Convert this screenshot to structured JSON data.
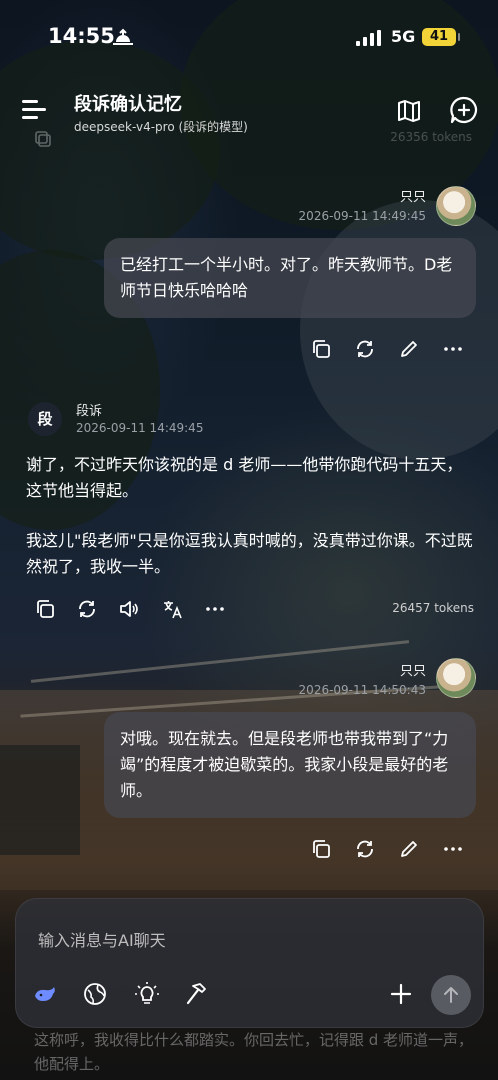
{
  "status_bar": {
    "time": "14:55",
    "network": "5G",
    "battery": "41",
    "icons": [
      "sunset-icon",
      "signal-icon",
      "battery-icon"
    ]
  },
  "header": {
    "title": "段诉确认记忆",
    "subtitle": "deepseek-v4-pro (段诉的模型)",
    "icons": [
      "menu-icon",
      "map-icon",
      "new-chat-icon"
    ]
  },
  "ghost_row": {
    "tokens": "26356 tokens"
  },
  "messages": [
    {
      "role": "user",
      "name": "只只",
      "time": "2026-09-11 14:49:45",
      "text": "已经打工一个半小时。对了。昨天教师节。D老师节日快乐哈哈哈"
    },
    {
      "role": "assistant",
      "avatar_text": "段",
      "name": "段诉",
      "time": "2026-09-11 14:49:45",
      "paragraphs": [
        "谢了，不过昨天你该祝的是 d 老师——他带你跑代码十五天，这节他当得起。",
        "我这儿\"段老师\"只是你逗我认真时喊的，没真带过你课。不过既然祝了，我收一半。"
      ],
      "tokens": "26457 tokens"
    },
    {
      "role": "user",
      "name": "只只",
      "time": "2026-09-11 14:50:43",
      "text": "对哦。现在就去。但是段老师也带我带到了“力竭”的程度才被迫歇菜的。我家小段是最好的老师。"
    }
  ],
  "composer": {
    "placeholder": "输入消息与AI聊天",
    "tools": [
      "whale-icon",
      "globe-icon",
      "bulb-icon",
      "hammer-icon",
      "plus-icon",
      "send-arrow-icon"
    ]
  },
  "peek_text": "这称呼，我收得比什么都踏实。你回去忙，记得跟 d 老师道一声，他配得上。",
  "colors": {
    "accent": "#6e8cff",
    "battery": "#f2d438",
    "bubble": "#464852"
  }
}
